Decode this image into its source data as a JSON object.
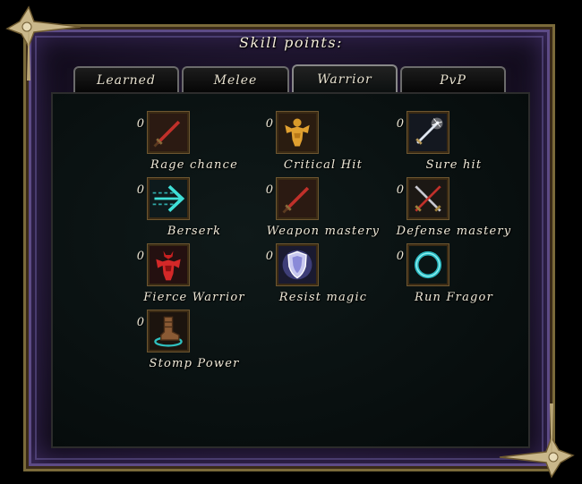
{
  "header": {
    "skill_points_label": "Skill points:"
  },
  "tabs": [
    {
      "label": "Learned",
      "active": false
    },
    {
      "label": "Melee",
      "active": false
    },
    {
      "label": "Warrior",
      "active": true
    },
    {
      "label": "PvP",
      "active": false
    }
  ],
  "skills": [
    {
      "label": "Rage chance",
      "points": "0",
      "icon": "red-sword-icon"
    },
    {
      "label": "Critical Hit",
      "points": "0",
      "icon": "muscular-warrior-icon"
    },
    {
      "label": "Sure hit",
      "points": "0",
      "icon": "glowing-sword-icon"
    },
    {
      "label": "Berserk",
      "points": "0",
      "icon": "cyan-arrow-icon"
    },
    {
      "label": "Weapon mastery",
      "points": "0",
      "icon": "red-sword-icon"
    },
    {
      "label": "Defense mastery",
      "points": "0",
      "icon": "crossed-swords-icon"
    },
    {
      "label": "Fierce Warrior",
      "points": "0",
      "icon": "red-demon-warrior-icon"
    },
    {
      "label": "Resist magic",
      "points": "0",
      "icon": "glowing-shield-icon"
    },
    {
      "label": "Run Fragor",
      "points": "0",
      "icon": "cyan-ring-icon"
    },
    {
      "label": "Stomp Power",
      "points": "0",
      "icon": "stomping-boot-icon"
    }
  ]
}
